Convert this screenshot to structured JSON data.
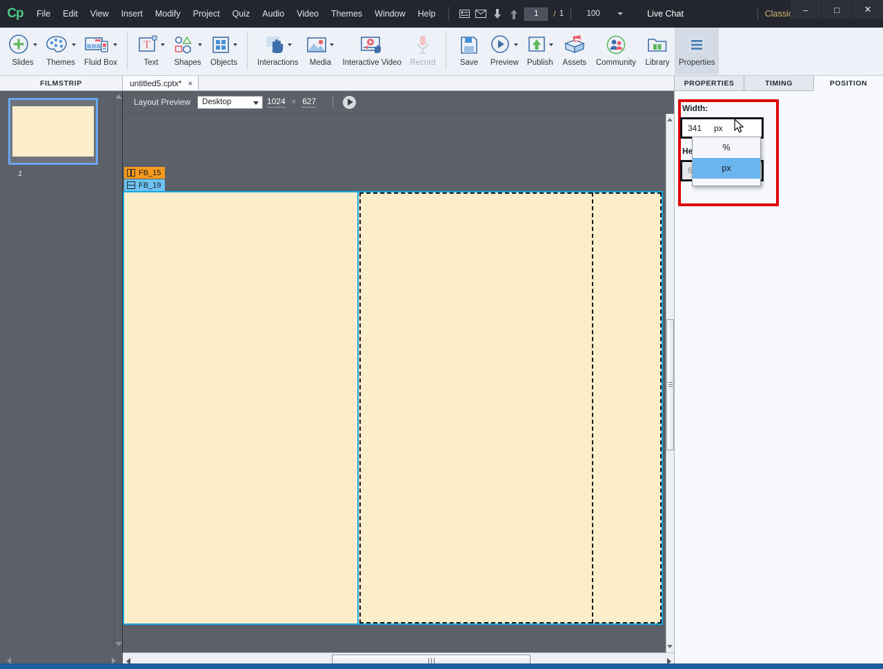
{
  "app": {
    "logo": "Cp",
    "menu": [
      "File",
      "Edit",
      "View",
      "Insert",
      "Modify",
      "Project",
      "Quiz",
      "Audio",
      "Video",
      "Themes",
      "Window",
      "Help"
    ],
    "page_current": "1",
    "page_separator": "/",
    "page_total": "1",
    "zoom_level": "100",
    "live_chat": "Live Chat",
    "workspace": "Classic",
    "window_buttons": {
      "minimize": "–",
      "maximize": "□",
      "close": "✕"
    }
  },
  "ribbon": {
    "tools": [
      {
        "label": "Slides",
        "icon": "slides-plus-icon",
        "caret": true,
        "disabled": false,
        "active": false
      },
      {
        "label": "Themes",
        "icon": "palette-icon",
        "caret": true,
        "disabled": false,
        "active": false
      },
      {
        "label": "Fluid Box",
        "icon": "fluid-box-icon",
        "caret": true,
        "disabled": false,
        "active": false
      },
      {
        "label": "Text",
        "icon": "text-box-icon",
        "caret": true,
        "disabled": false,
        "active": false
      },
      {
        "label": "Shapes",
        "icon": "shapes-icon",
        "caret": true,
        "disabled": false,
        "active": false
      },
      {
        "label": "Objects",
        "icon": "objects-grid-icon",
        "caret": true,
        "disabled": false,
        "active": false
      },
      {
        "label": "Interactions",
        "icon": "interactions-hand-icon",
        "caret": true,
        "disabled": false,
        "active": false
      },
      {
        "label": "Media",
        "icon": "media-image-icon",
        "caret": true,
        "disabled": false,
        "active": false
      },
      {
        "label": "Interactive Video",
        "icon": "interactive-video-icon",
        "caret": false,
        "disabled": false,
        "active": false
      },
      {
        "label": "Record",
        "icon": "microphone-icon",
        "caret": false,
        "disabled": true,
        "active": false
      },
      {
        "label": "Save",
        "icon": "floppy-disk-icon",
        "caret": false,
        "disabled": false,
        "active": false
      },
      {
        "label": "Preview",
        "icon": "play-circle-icon",
        "caret": true,
        "disabled": false,
        "active": false
      },
      {
        "label": "Publish",
        "icon": "publish-upload-icon",
        "caret": true,
        "disabled": false,
        "active": false
      },
      {
        "label": "Assets",
        "icon": "assets-box-icon",
        "caret": false,
        "disabled": false,
        "active": false
      },
      {
        "label": "Community",
        "icon": "community-people-icon",
        "caret": false,
        "disabled": false,
        "active": false
      },
      {
        "label": "Library",
        "icon": "library-folder-icon",
        "caret": false,
        "disabled": false,
        "active": false
      },
      {
        "label": "Properties",
        "icon": "properties-lines-icon",
        "caret": false,
        "disabled": false,
        "active": true
      }
    ]
  },
  "tabs": {
    "filmstrip_label": "FILMSTRIP",
    "document": "untitled5.cptx*",
    "close_glyph": "×"
  },
  "filmstrip": {
    "slides": [
      {
        "number": "1"
      }
    ]
  },
  "layout_bar": {
    "label": "Layout Preview",
    "device": "Desktop",
    "width": "1024",
    "x": "×",
    "height": "627"
  },
  "stage": {
    "fluid_boxes": [
      {
        "name": "FB_15",
        "icon": "columns-icon",
        "color": "#f79a1e"
      },
      {
        "name": "FB_19",
        "icon": "rows-icon",
        "color": "#6cc3f2"
      }
    ],
    "canvas_color": "#fcedcb",
    "selection_color": "#13a8dd"
  },
  "panel": {
    "tabs": [
      {
        "label": "PROPERTIES",
        "selected": false
      },
      {
        "label": "TIMING",
        "selected": false
      },
      {
        "label": "POSITION",
        "selected": true
      }
    ],
    "width_label": "Width:",
    "width_value": "341",
    "width_unit": "px",
    "height_label": "Height:",
    "height_value": "62",
    "unit_options": [
      {
        "label": "%",
        "selected": false
      },
      {
        "label": "px",
        "selected": true
      }
    ],
    "highlight_color": "#e00000"
  }
}
